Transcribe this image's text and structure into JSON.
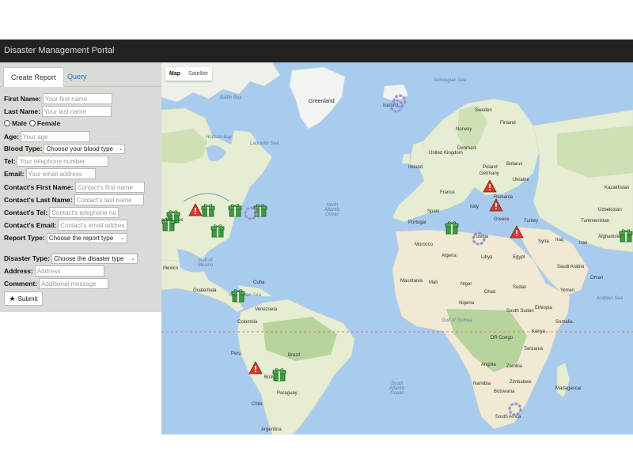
{
  "app": {
    "title": "Disaster Management Portal"
  },
  "tabs": [
    {
      "label": "Create Report"
    },
    {
      "label": "Query"
    }
  ],
  "form": {
    "first_name": {
      "label": "First Name:",
      "placeholder": "Your first name"
    },
    "last_name": {
      "label": "Last Name:",
      "placeholder": "Your last name"
    },
    "gender": {
      "male": "Male",
      "female": "Female"
    },
    "age": {
      "label": "Age:",
      "placeholder": "Your age"
    },
    "blood_type": {
      "label": "Blood Type:",
      "value": "Choose your blood type"
    },
    "tel": {
      "label": "Tel:",
      "placeholder": "Your telephone number"
    },
    "email": {
      "label": "Email:",
      "placeholder": "Your email address"
    },
    "contact_first": {
      "label": "Contact's First Name:",
      "placeholder": "Contact's first name"
    },
    "contact_last": {
      "label": "Contact's Last Name:",
      "placeholder": "Contact's last name"
    },
    "contact_tel": {
      "label": "Contact's Tel:",
      "placeholder": "Contact's telephone number"
    },
    "contact_email": {
      "label": "Contact's Email:",
      "placeholder": "Contact's email address"
    },
    "report_type": {
      "label": "Report Type:",
      "value": "Choose the report type"
    },
    "disaster_type": {
      "label": "Disaster Type:",
      "value": "Choose the disaster type"
    },
    "address": {
      "label": "Address:",
      "placeholder": "Address"
    },
    "comment": {
      "label": "Comment:",
      "placeholder": "Additional message"
    },
    "submit": "Submit"
  },
  "map": {
    "type_buttons": [
      "Map",
      "Satellite"
    ],
    "colors": {
      "water": "#a9ccee",
      "land": "#e6edd2",
      "forest": "#b7d49b",
      "desert": "#f0ead4",
      "ice": "#f2f4f2"
    },
    "labels": {
      "greenland": "Greenland",
      "iceland": "Iceland",
      "norwegian_sea": "Norwegian Sea",
      "sweden": "Sweden",
      "finland": "Finland",
      "norway": "Norway",
      "united_kingdom": "United Kingdom",
      "ireland": "Ireland",
      "denmark": "Denmark",
      "germany": "Germany",
      "poland": "Poland",
      "belarus": "Belarus",
      "ukraine": "Ukraine",
      "france": "France",
      "spain": "Spain",
      "portugal": "Portugal",
      "italy": "Italy",
      "romania": "Romania",
      "greece": "Greece",
      "turkey": "Turkey",
      "tunisia": "Tunisia",
      "morocco": "Morocco",
      "algeria": "Algeria",
      "libya": "Libya",
      "egypt": "Egypt",
      "iraq": "Iraq",
      "iran": "Iran",
      "syria": "Syria",
      "saudi_arabia": "Saudi Arabia",
      "kazakhstan": "Kazakhstan",
      "uzbekistan": "Uzbekistan",
      "turkmenistan": "Turkmenistan",
      "afghanistan": "Afghanistan",
      "oman": "Oman",
      "yemen": "Yemen",
      "mauritania": "Mauritania",
      "mali": "Mali",
      "niger": "Niger",
      "chad": "Chad",
      "sudan": "Sudan",
      "nigeria": "Nigeria",
      "ethiopia": "Ethiopia",
      "south_sudan": "South Sudan",
      "somalia": "Somalia",
      "kenya": "Kenya",
      "tanzania": "Tanzania",
      "dr_congo": "DR Congo",
      "angola": "Angola",
      "zambia": "Zambia",
      "namibia": "Namibia",
      "zimbabwe": "Zimbabwe",
      "botswana": "Botswana",
      "madagascar": "Madagascar",
      "south_africa": "South Africa",
      "gulf_of_guinea": "Gulf of Guinea",
      "north_atlantic": "North\nAtlantic\nOcean",
      "south_atlantic": "South\nAtlantic\nOcean",
      "arabian_sea": "Arabian Sea",
      "hudson_bay": "Hudson Bay",
      "labrador_sea": "Labrador Sea",
      "baffin_bay": "Baffin Bay",
      "gulf_of_mexico": "Gulf of\nMexico",
      "mexico": "Mexico",
      "cuba": "Cuba",
      "guatemala": "Guatemala",
      "caribbean_sea": "Caribbean Sea",
      "venezuela": "Venezuela",
      "colombia": "Colombia",
      "peru": "Peru",
      "brazil": "Brazil",
      "bolivia": "Bolivia",
      "paraguay": "Paraguay",
      "chile": "Chile",
      "argentina": "Argentina",
      "united_states": "ed States"
    },
    "markers": [
      {
        "type": "gift"
      },
      {
        "type": "gift"
      },
      {
        "type": "gift"
      },
      {
        "type": "gift"
      },
      {
        "type": "gift"
      },
      {
        "type": "gift"
      },
      {
        "type": "gift"
      },
      {
        "type": "gift"
      },
      {
        "type": "gift"
      },
      {
        "type": "gift"
      },
      {
        "type": "warning"
      },
      {
        "type": "warning"
      },
      {
        "type": "warning"
      },
      {
        "type": "warning"
      },
      {
        "type": "warning"
      },
      {
        "type": "lifebuoy"
      },
      {
        "type": "lifebuoy"
      },
      {
        "type": "lifebuoy"
      },
      {
        "type": "lifebuoy"
      },
      {
        "type": "lifebuoy"
      }
    ]
  }
}
